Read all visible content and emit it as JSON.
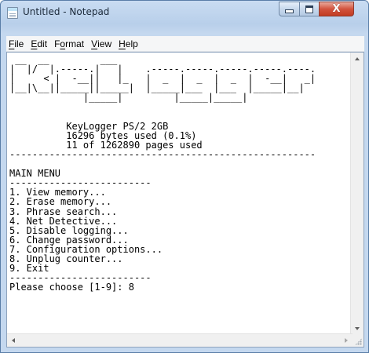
{
  "window": {
    "title": "Untitled - Notepad",
    "app_icon": "notepad-icon",
    "controls": {
      "minimize": "minimize-icon",
      "maximize": "maximize-icon",
      "close": "close-icon",
      "close_glyph": "X"
    }
  },
  "menu": {
    "items": [
      {
        "pre": "",
        "key": "F",
        "rest": "ile"
      },
      {
        "pre": "",
        "key": "E",
        "rest": "dit"
      },
      {
        "pre": "F",
        "key": "o",
        "rest": "rmat"
      },
      {
        "pre": "",
        "key": "V",
        "rest": "iew"
      },
      {
        "pre": "",
        "key": "H",
        "rest": "elp"
      }
    ]
  },
  "document": {
    "content": " __  __         ___                                   \n|  |/  |.-----.|   |    .-----.-----.-----.-----.----.\n|     < |  -__||   |_   |  _  |  _  |  _  |  -__|   _|\n|__|\\__||_____||_____|  |_____|___  |___  |_____|__|  \n             |_____|         |_____|_____|            \n\n\n          KeyLogger PS/2 2GB\n          16296 bytes used (0.1%)\n          11 of 1262890 pages used\n------------------------------------------------------\n\nMAIN MENU\n-------------------------\n1. View memory...\n2. Erase memory...\n3. Phrase search...\n4. Net Detective...\n5. Disable logging...\n6. Change password...\n7. Configuration options...\n8. Unplug counter...\n9. Exit\n-------------------------\nPlease choose [1-9]: 8"
  },
  "colors": {
    "titlebar": "#c9dcf2",
    "close_button": "#d2533e",
    "editor_bg": "#ffffff"
  }
}
